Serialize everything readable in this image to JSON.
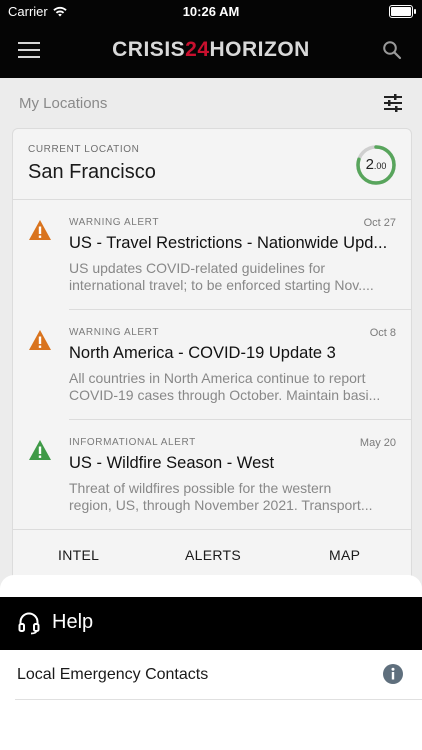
{
  "status_bar": {
    "carrier": "Carrier",
    "time": "10:26 AM"
  },
  "header": {
    "logo_part1": "CRISIS",
    "logo_number": "24",
    "logo_part2": "HORIZON"
  },
  "my_locations": {
    "label": "My Locations"
  },
  "current_location": {
    "label": "CURRENT LOCATION",
    "city": "San Francisco",
    "risk_whole": "2",
    "risk_decimal": ".00",
    "risk_value": 2.0,
    "ring_color": "#58a55c"
  },
  "alerts": [
    {
      "type": "WARNING ALERT",
      "date": "Oct 27",
      "title": "US - Travel Restrictions - Nationwide Upd...",
      "body_line1": "US updates COVID-related guidelines for",
      "body_line2": "international travel; to be enforced starting Nov....",
      "icon": "warning-icon",
      "color": "#d9731d"
    },
    {
      "type": "WARNING ALERT",
      "date": "Oct 8",
      "title": "North America - COVID-19 Update 3",
      "body_line1": "All countries in North America continue to report",
      "body_line2": "COVID-19 cases through October. Maintain basi...",
      "icon": "warning-icon",
      "color": "#d9731d"
    },
    {
      "type": "INFORMATIONAL ALERT",
      "date": "May 20",
      "title": "US - Wildfire Season - West",
      "body_line1": "Threat of wildfires possible for the western",
      "body_line2": "region, US, through November 2021. Transport...",
      "icon": "info-triangle-icon",
      "color": "#3f9a47"
    }
  ],
  "tabs": {
    "intel": "INTEL",
    "alerts": "ALERTS",
    "map": "MAP"
  },
  "sheet": {
    "help_label": "Help",
    "help_icon": "headset-icon",
    "contacts_label": "Local Emergency Contacts",
    "contacts_icon": "info-icon"
  },
  "colors": {
    "brand_red": "#c8102e",
    "header_bg": "#050505",
    "info_icon": "#5f6f7d"
  }
}
